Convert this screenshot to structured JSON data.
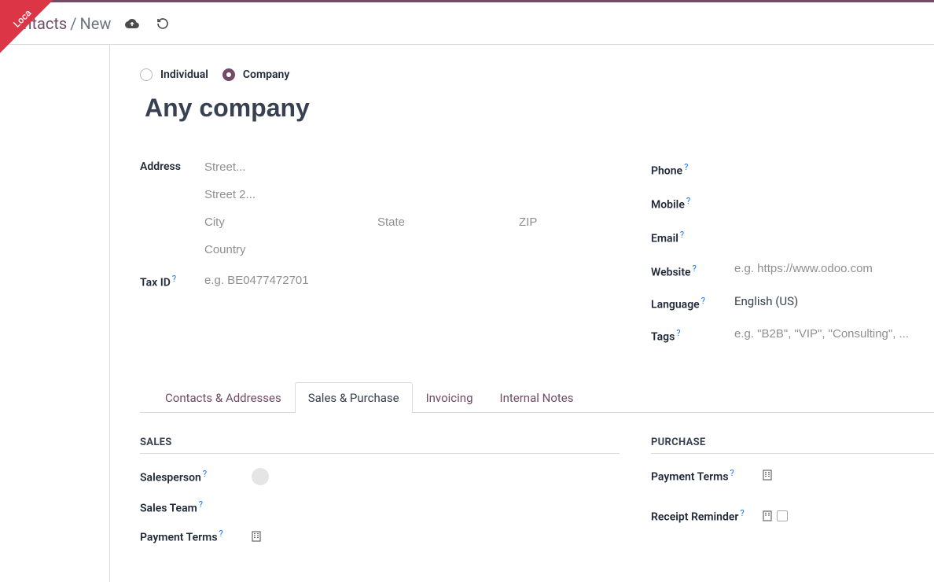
{
  "ribbon": {
    "text": "Loca"
  },
  "breadcrumb": {
    "root": "Contacts",
    "separator": "/",
    "current": "New"
  },
  "contact_type": {
    "individual": {
      "label": "Individual",
      "checked": false
    },
    "company": {
      "label": "Company",
      "checked": true
    }
  },
  "title": "Any company",
  "fields_left": {
    "address": {
      "label": "Address",
      "street_placeholder": "Street...",
      "street2_placeholder": "Street 2...",
      "city_placeholder": "City",
      "state_placeholder": "State",
      "zip_placeholder": "ZIP",
      "country_placeholder": "Country"
    },
    "tax_id": {
      "label": "Tax ID",
      "placeholder": "e.g. BE0477472701"
    }
  },
  "fields_right": {
    "phone": {
      "label": "Phone"
    },
    "mobile": {
      "label": "Mobile"
    },
    "email": {
      "label": "Email"
    },
    "website": {
      "label": "Website",
      "placeholder": "e.g. https://www.odoo.com"
    },
    "language": {
      "label": "Language",
      "value": "English (US)"
    },
    "tags": {
      "label": "Tags",
      "placeholder": "e.g. \"B2B\", \"VIP\", \"Consulting\", ..."
    }
  },
  "tabs": [
    {
      "id": "contacts",
      "label": "Contacts & Addresses",
      "active": false
    },
    {
      "id": "sales",
      "label": "Sales & Purchase",
      "active": true
    },
    {
      "id": "invoicing",
      "label": "Invoicing",
      "active": false
    },
    {
      "id": "notes",
      "label": "Internal Notes",
      "active": false
    }
  ],
  "sections": {
    "sales": {
      "title": "SALES",
      "salesperson": {
        "label": "Salesperson"
      },
      "sales_team": {
        "label": "Sales Team"
      },
      "payment_terms": {
        "label": "Payment Terms"
      }
    },
    "purchase": {
      "title": "PURCHASE",
      "payment_terms": {
        "label": "Payment Terms"
      },
      "receipt_reminder": {
        "label": "Receipt Reminder"
      }
    }
  },
  "help_marker": "?"
}
